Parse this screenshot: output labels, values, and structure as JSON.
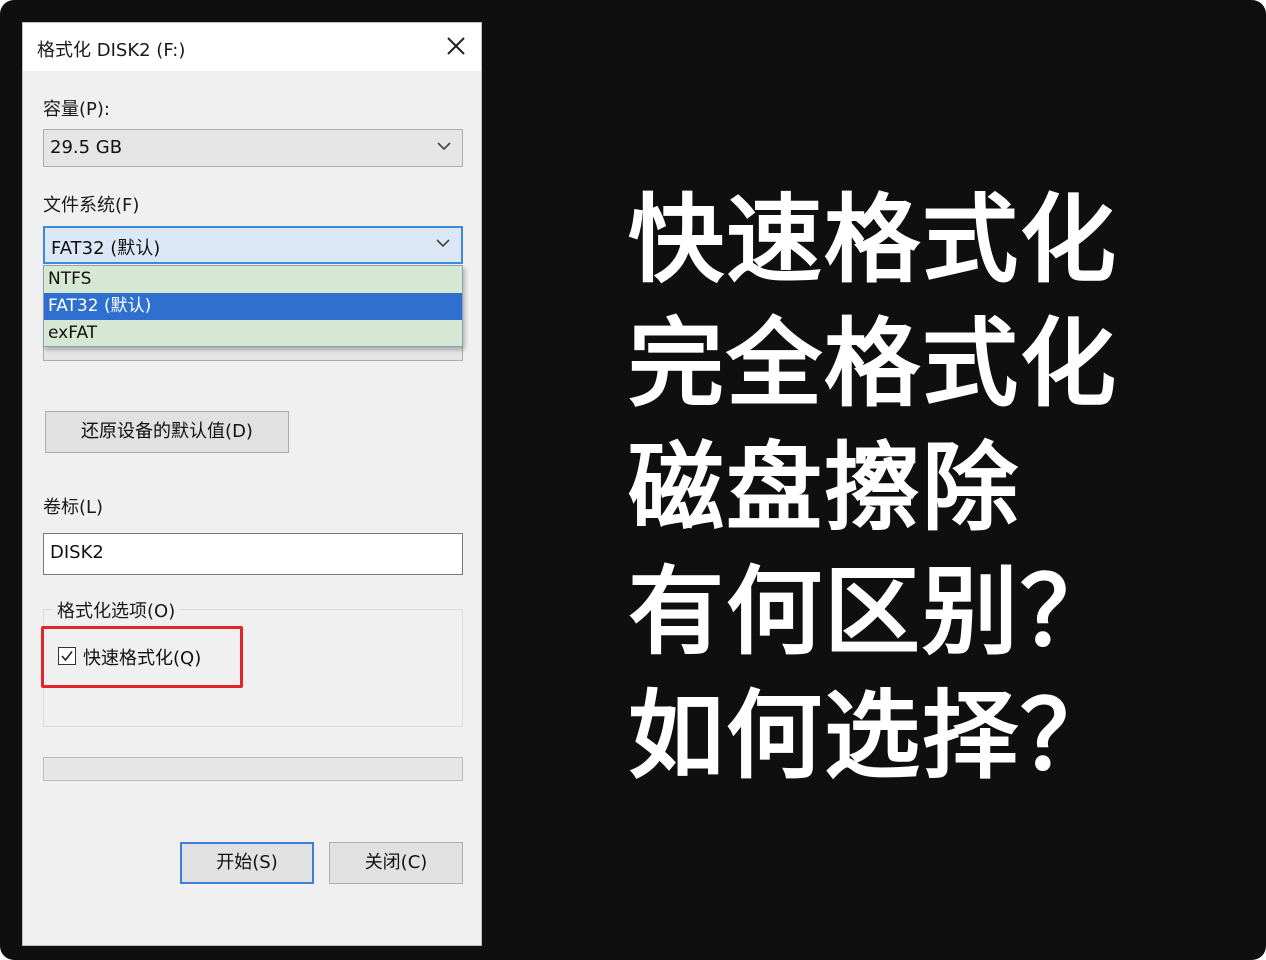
{
  "dialog": {
    "title": "格式化 DISK2 (F:)",
    "capacity_label": "容量(P):",
    "capacity_value": "29.5 GB",
    "filesystem_label": "文件系统(F)",
    "filesystem_value": "FAT32 (默认)",
    "filesystem_options": [
      "NTFS",
      "FAT32 (默认)",
      "exFAT"
    ],
    "filesystem_selected_index": 1,
    "restore_defaults_label": "还原设备的默认值(D)",
    "volume_label_label": "卷标(L)",
    "volume_label_value": "DISK2",
    "format_options_label": "格式化选项(O)",
    "quick_format_label": "快速格式化(Q)",
    "quick_format_checked": true,
    "progress_fraction": 0,
    "start_label": "开始(S)",
    "close_label": "关闭(C)",
    "icons": [
      "close-icon",
      "chevron-down-icon",
      "checkmark-icon"
    ]
  },
  "headline": {
    "lines": [
      "快速格式化",
      "完全格式化",
      "磁盘擦除",
      "有何区别？",
      "如何选择？"
    ]
  },
  "colors": {
    "background": "#0f0f0f",
    "dialog_bg": "#f0f0f0",
    "selection_blue": "#2f6fd0",
    "dropdown_bg": "#d6e8d3",
    "highlight_red": "#e0262b",
    "headline_text": "#ffffff"
  }
}
